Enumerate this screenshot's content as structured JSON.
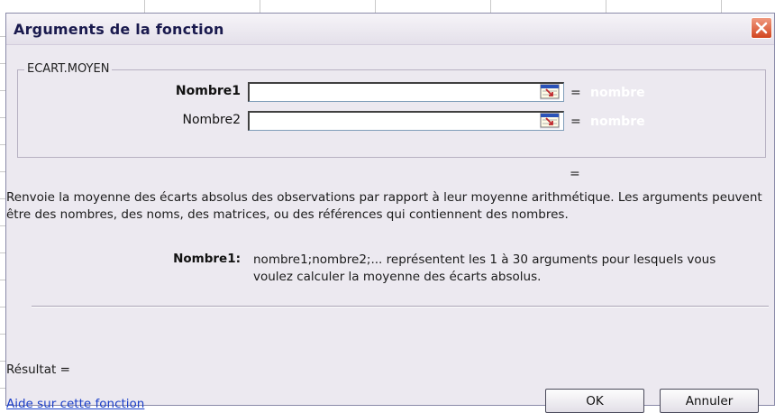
{
  "dialog": {
    "title": "Arguments de la fonction",
    "function_name": "ECART.MOYEN",
    "arguments": [
      {
        "label": "Nombre1",
        "value": "",
        "equals": "=",
        "hint": "nombre"
      },
      {
        "label": "Nombre2",
        "value": "",
        "equals": "=",
        "hint": "nombre"
      }
    ],
    "result_equals": "=",
    "description": "Renvoie la moyenne des écarts absolus des observations par rapport à leur moyenne arithmétique. Les arguments peuvent être des nombres, des noms, des matrices, ou des références qui contiennent des nombres.",
    "param_name": "Nombre1:",
    "param_description": "nombre1;nombre2;... représentent les 1 à 30 arguments pour lesquels vous voulez calculer la moyenne des écarts absolus.",
    "result_label": "Résultat =",
    "help_link": "Aide sur cette fonction",
    "ok_label": "OK",
    "cancel_label": "Annuler"
  },
  "icons": {
    "close": "close-icon",
    "range_picker": "collapse-dialog-icon"
  },
  "colors": {
    "dialog_bg": "#ece9f0",
    "title_text": "#1a1a4e",
    "close_button": "#d2451f",
    "link": "#1a3ec8"
  }
}
